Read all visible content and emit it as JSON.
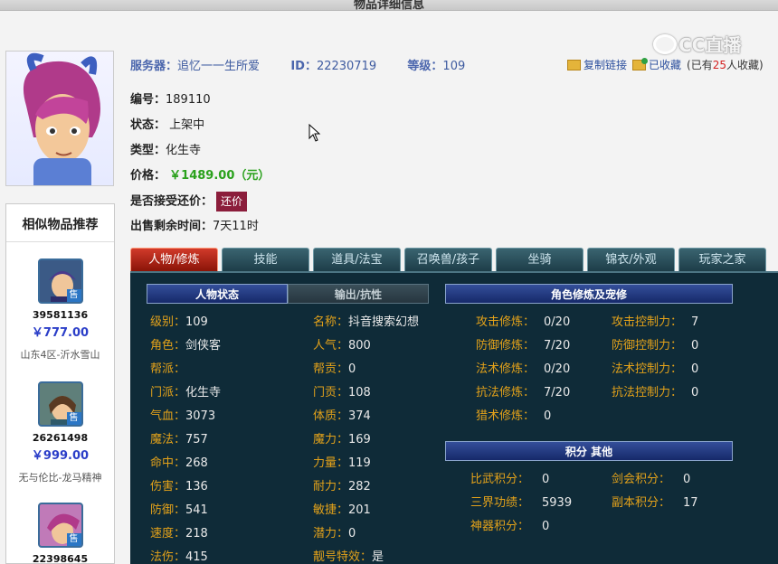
{
  "page": {
    "title": "物品详细信息"
  },
  "watermark": "CC直播",
  "header": {
    "server_label": "服务器：",
    "server": "追忆一一生所爱",
    "id_label": "ID：",
    "id": "22230719",
    "level_label": "等级：",
    "level": "109"
  },
  "actions": {
    "copy_link": "复制链接",
    "favorited": "已收藏",
    "fav_prefix": "(已有",
    "fav_count": "25",
    "fav_suffix": "人收藏)"
  },
  "fields": {
    "serial_label": "编号：",
    "serial": "189110",
    "status_label": "状态：",
    "status": "上架中",
    "type_label": "类型：",
    "type": "化生寺",
    "price_label": "价格：",
    "price": "￥1489.00（元）",
    "bargain_label": "是否接受还价：",
    "bargain_button": "还价",
    "remaining_label": "出售剩余时间：",
    "remaining": "7天11时"
  },
  "sidebar": {
    "title": "相似物品推荐",
    "sell_badge": "售",
    "items": [
      {
        "id": "39581136",
        "price": "￥777.00",
        "server": "山东4区-沂水雪山"
      },
      {
        "id": "26261498",
        "price": "￥999.00",
        "server": "无与伦比-龙马精神"
      },
      {
        "id": "22398645"
      }
    ]
  },
  "tabs": [
    "人物/修炼",
    "技能",
    "道具/法宝",
    "召唤兽/孩子",
    "坐骑",
    "锦衣/外观",
    "玩家之家"
  ],
  "panel": {
    "subtab_status": "人物状态",
    "subtab_output": "输出/抗性",
    "section_cultivation": "角色修炼及宠修",
    "section_points": "积分 其他",
    "left_col": [
      {
        "k": "级别：",
        "v": "109"
      },
      {
        "k": "角色：",
        "v": "剑侠客"
      },
      {
        "k": "帮派：",
        "v": ""
      },
      {
        "k": "门派：",
        "v": "化生寺"
      },
      {
        "k": "气血：",
        "v": "3073"
      },
      {
        "k": "魔法：",
        "v": "757"
      },
      {
        "k": "命中：",
        "v": "268"
      },
      {
        "k": "伤害：",
        "v": "136"
      },
      {
        "k": "防御：",
        "v": "541"
      },
      {
        "k": "速度：",
        "v": "218"
      },
      {
        "k": "法伤：",
        "v": "415"
      }
    ],
    "mid_col": [
      {
        "k": "名称：",
        "v": "抖音搜索幻想"
      },
      {
        "k": "人气：",
        "v": "800"
      },
      {
        "k": "帮贡：",
        "v": "0"
      },
      {
        "k": "门贡：",
        "v": "108"
      },
      {
        "k": "体质：",
        "v": "374"
      },
      {
        "k": "魔力：",
        "v": "169"
      },
      {
        "k": "力量：",
        "v": "119"
      },
      {
        "k": "耐力：",
        "v": "282"
      },
      {
        "k": "敏捷：",
        "v": "201"
      },
      {
        "k": "潜力：",
        "v": "0"
      },
      {
        "k": "靓号特效：",
        "v": "是"
      }
    ],
    "cult_left": [
      {
        "k": "攻击修炼：",
        "v": "0/20"
      },
      {
        "k": "防御修炼：",
        "v": "7/20"
      },
      {
        "k": "法术修炼：",
        "v": "0/20"
      },
      {
        "k": "抗法修炼：",
        "v": "7/20"
      },
      {
        "k": "猎术修炼：",
        "v": "0"
      }
    ],
    "cult_right": [
      {
        "k": "攻击控制力：",
        "v": "7"
      },
      {
        "k": "防御控制力：",
        "v": "0"
      },
      {
        "k": "法术控制力：",
        "v": "0"
      },
      {
        "k": "抗法控制力：",
        "v": "0"
      }
    ],
    "points_left": [
      {
        "k": "比武积分：",
        "v": "0"
      },
      {
        "k": "三界功绩：",
        "v": "5939"
      },
      {
        "k": "神器积分：",
        "v": "0"
      }
    ],
    "points_right": [
      {
        "k": "剑会积分：",
        "v": "0"
      },
      {
        "k": "副本积分：",
        "v": "17"
      }
    ]
  }
}
